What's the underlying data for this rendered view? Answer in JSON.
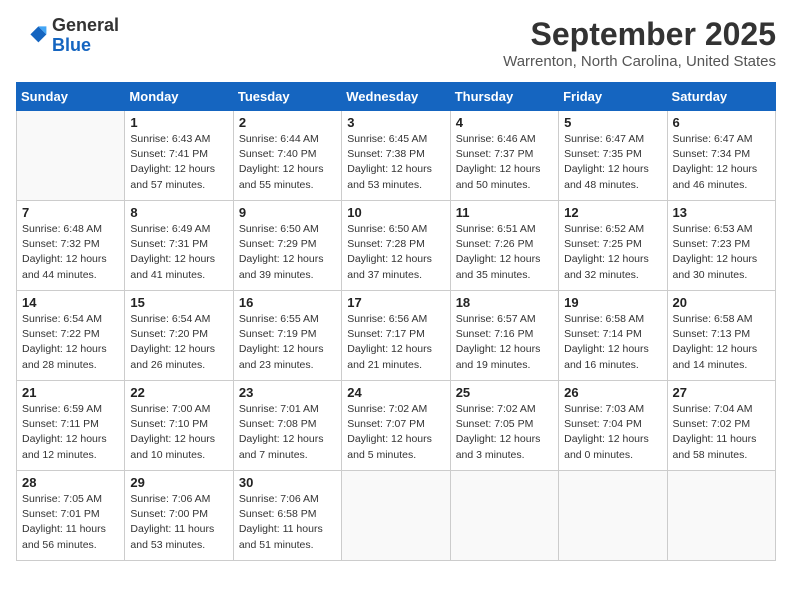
{
  "header": {
    "logo_general": "General",
    "logo_blue": "Blue",
    "month": "September 2025",
    "location": "Warrenton, North Carolina, United States"
  },
  "weekdays": [
    "Sunday",
    "Monday",
    "Tuesday",
    "Wednesday",
    "Thursday",
    "Friday",
    "Saturday"
  ],
  "weeks": [
    [
      {
        "day": "",
        "info": ""
      },
      {
        "day": "1",
        "info": "Sunrise: 6:43 AM\nSunset: 7:41 PM\nDaylight: 12 hours\nand 57 minutes."
      },
      {
        "day": "2",
        "info": "Sunrise: 6:44 AM\nSunset: 7:40 PM\nDaylight: 12 hours\nand 55 minutes."
      },
      {
        "day": "3",
        "info": "Sunrise: 6:45 AM\nSunset: 7:38 PM\nDaylight: 12 hours\nand 53 minutes."
      },
      {
        "day": "4",
        "info": "Sunrise: 6:46 AM\nSunset: 7:37 PM\nDaylight: 12 hours\nand 50 minutes."
      },
      {
        "day": "5",
        "info": "Sunrise: 6:47 AM\nSunset: 7:35 PM\nDaylight: 12 hours\nand 48 minutes."
      },
      {
        "day": "6",
        "info": "Sunrise: 6:47 AM\nSunset: 7:34 PM\nDaylight: 12 hours\nand 46 minutes."
      }
    ],
    [
      {
        "day": "7",
        "info": "Sunrise: 6:48 AM\nSunset: 7:32 PM\nDaylight: 12 hours\nand 44 minutes."
      },
      {
        "day": "8",
        "info": "Sunrise: 6:49 AM\nSunset: 7:31 PM\nDaylight: 12 hours\nand 41 minutes."
      },
      {
        "day": "9",
        "info": "Sunrise: 6:50 AM\nSunset: 7:29 PM\nDaylight: 12 hours\nand 39 minutes."
      },
      {
        "day": "10",
        "info": "Sunrise: 6:50 AM\nSunset: 7:28 PM\nDaylight: 12 hours\nand 37 minutes."
      },
      {
        "day": "11",
        "info": "Sunrise: 6:51 AM\nSunset: 7:26 PM\nDaylight: 12 hours\nand 35 minutes."
      },
      {
        "day": "12",
        "info": "Sunrise: 6:52 AM\nSunset: 7:25 PM\nDaylight: 12 hours\nand 32 minutes."
      },
      {
        "day": "13",
        "info": "Sunrise: 6:53 AM\nSunset: 7:23 PM\nDaylight: 12 hours\nand 30 minutes."
      }
    ],
    [
      {
        "day": "14",
        "info": "Sunrise: 6:54 AM\nSunset: 7:22 PM\nDaylight: 12 hours\nand 28 minutes."
      },
      {
        "day": "15",
        "info": "Sunrise: 6:54 AM\nSunset: 7:20 PM\nDaylight: 12 hours\nand 26 minutes."
      },
      {
        "day": "16",
        "info": "Sunrise: 6:55 AM\nSunset: 7:19 PM\nDaylight: 12 hours\nand 23 minutes."
      },
      {
        "day": "17",
        "info": "Sunrise: 6:56 AM\nSunset: 7:17 PM\nDaylight: 12 hours\nand 21 minutes."
      },
      {
        "day": "18",
        "info": "Sunrise: 6:57 AM\nSunset: 7:16 PM\nDaylight: 12 hours\nand 19 minutes."
      },
      {
        "day": "19",
        "info": "Sunrise: 6:58 AM\nSunset: 7:14 PM\nDaylight: 12 hours\nand 16 minutes."
      },
      {
        "day": "20",
        "info": "Sunrise: 6:58 AM\nSunset: 7:13 PM\nDaylight: 12 hours\nand 14 minutes."
      }
    ],
    [
      {
        "day": "21",
        "info": "Sunrise: 6:59 AM\nSunset: 7:11 PM\nDaylight: 12 hours\nand 12 minutes."
      },
      {
        "day": "22",
        "info": "Sunrise: 7:00 AM\nSunset: 7:10 PM\nDaylight: 12 hours\nand 10 minutes."
      },
      {
        "day": "23",
        "info": "Sunrise: 7:01 AM\nSunset: 7:08 PM\nDaylight: 12 hours\nand 7 minutes."
      },
      {
        "day": "24",
        "info": "Sunrise: 7:02 AM\nSunset: 7:07 PM\nDaylight: 12 hours\nand 5 minutes."
      },
      {
        "day": "25",
        "info": "Sunrise: 7:02 AM\nSunset: 7:05 PM\nDaylight: 12 hours\nand 3 minutes."
      },
      {
        "day": "26",
        "info": "Sunrise: 7:03 AM\nSunset: 7:04 PM\nDaylight: 12 hours\nand 0 minutes."
      },
      {
        "day": "27",
        "info": "Sunrise: 7:04 AM\nSunset: 7:02 PM\nDaylight: 11 hours\nand 58 minutes."
      }
    ],
    [
      {
        "day": "28",
        "info": "Sunrise: 7:05 AM\nSunset: 7:01 PM\nDaylight: 11 hours\nand 56 minutes."
      },
      {
        "day": "29",
        "info": "Sunrise: 7:06 AM\nSunset: 7:00 PM\nDaylight: 11 hours\nand 53 minutes."
      },
      {
        "day": "30",
        "info": "Sunrise: 7:06 AM\nSunset: 6:58 PM\nDaylight: 11 hours\nand 51 minutes."
      },
      {
        "day": "",
        "info": ""
      },
      {
        "day": "",
        "info": ""
      },
      {
        "day": "",
        "info": ""
      },
      {
        "day": "",
        "info": ""
      }
    ]
  ]
}
